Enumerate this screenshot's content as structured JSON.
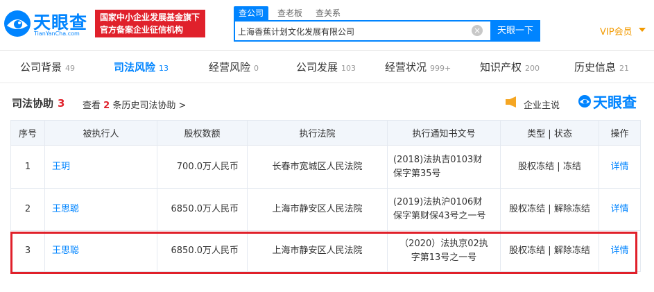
{
  "brand": {
    "name": "天眼查",
    "sub": "TianYanCha.com"
  },
  "badge": {
    "line1": "国家中小企业发展基金旗下",
    "line2": "官方备案企业征信机构"
  },
  "search": {
    "tabs": [
      "查公司",
      "查老板",
      "查关系"
    ],
    "value": "上海香蕉计划文化发展有限公司",
    "button": "天眼一下"
  },
  "vip": "VIP会员",
  "nav": [
    {
      "label": "公司背景",
      "count": "49"
    },
    {
      "label": "司法风险",
      "count": "13"
    },
    {
      "label": "经营风险",
      "count": "0"
    },
    {
      "label": "公司发展",
      "count": "103"
    },
    {
      "label": "经营状况",
      "count": "999+"
    },
    {
      "label": "知识产权",
      "count": "200"
    },
    {
      "label": "历史信息",
      "count": "21"
    }
  ],
  "section": {
    "title": "司法协助",
    "count": "3",
    "history_prefix": "查看",
    "history_count": "2",
    "history_suffix": "条历史司法协助 >",
    "enterprise_says": "企业主说",
    "brand": "天眼查"
  },
  "table": {
    "headers": [
      "序号",
      "被执行人",
      "股权数额",
      "执行法院",
      "执行通知书文号",
      "类型 | 状态",
      "操作"
    ],
    "rows": [
      {
        "no": "1",
        "name": "王玥",
        "amount": "700.0万人民币",
        "court": "长春市宽城区人民法院",
        "doc1": "(2018)法执吉0103财",
        "doc2": "保字第35号",
        "status": "股权冻结 | 冻结",
        "op": "详情"
      },
      {
        "no": "2",
        "name": "王思聪",
        "amount": "6850.0万人民币",
        "court": "上海市静安区人民法院",
        "doc1": "(2019)法执沪0106财",
        "doc2": "保字第财保43号之一号",
        "status": "股权冻结 | 解除冻结",
        "op": "详情"
      },
      {
        "no": "3",
        "name": "王思聪",
        "amount": "6850.0万人民币",
        "court": "上海市静安区人民法院",
        "doc1": "（2020）法执京02执",
        "doc2": "字第13号之一号",
        "status": "股权冻结 | 解除冻结",
        "op": "详情"
      }
    ]
  },
  "colors": {
    "accent": "#0084ff",
    "red": "#e0212b",
    "vip": "#f29a00",
    "header_bg": "#f2f6fb"
  }
}
